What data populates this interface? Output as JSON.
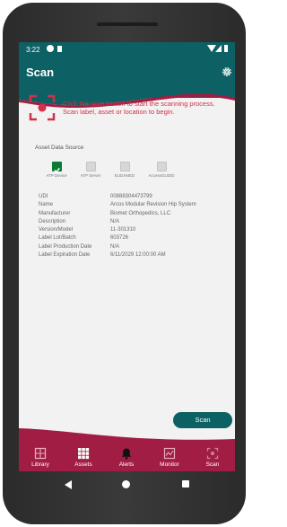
{
  "status": {
    "time": "3:22"
  },
  "appbar": {
    "title": "Scan"
  },
  "instruction": "Click the scan button to start the scanning process. Scan label, asset or location to begin.",
  "asset_data_source": {
    "label": "Asset Data Source",
    "sources": [
      {
        "label": "ATP Device",
        "checked": true
      },
      {
        "label": "ATP Server",
        "checked": false
      },
      {
        "label": "EUDAMED",
        "checked": false
      },
      {
        "label": "AccessGUDID",
        "checked": false
      }
    ]
  },
  "details": [
    {
      "key": "UDI",
      "value": "00888304473799"
    },
    {
      "key": "Name",
      "value": "Arcos Modular Revision Hip System"
    },
    {
      "key": "Manufacturer",
      "value": "Biomet Orthopedics, LLC"
    },
    {
      "key": "Description",
      "value": "N/A"
    },
    {
      "key": "Version/Model",
      "value": "11-301310"
    },
    {
      "key": "Label Lot/Batch",
      "value": "603726"
    },
    {
      "key": "Label Production Date",
      "value": "N/A"
    },
    {
      "key": "Label Expiration Date",
      "value": "6/11/2029 12:00:00 AM"
    }
  ],
  "scan_button": "Scan",
  "nav": [
    {
      "label": "Library",
      "icon": "library-icon"
    },
    {
      "label": "Assets",
      "icon": "grid-icon"
    },
    {
      "label": "Alerts",
      "icon": "bell-icon"
    },
    {
      "label": "Monitor",
      "icon": "monitor-icon"
    },
    {
      "label": "Scan",
      "icon": "scan-icon"
    }
  ],
  "colors": {
    "primary": "#0d6063",
    "accent": "#a11d43",
    "instruction": "#d0324a",
    "check": "#0d7a34"
  }
}
